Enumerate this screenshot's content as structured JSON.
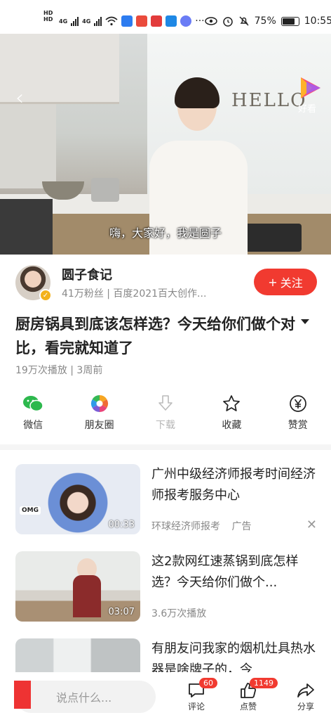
{
  "status_bar": {
    "network_labels": [
      "HD",
      "HD"
    ],
    "signal_labels": [
      "4G",
      "4G"
    ],
    "battery": "75%",
    "time": "10:55",
    "icons": [
      "wifi-icon",
      "app-icon-red",
      "app-icon-blue",
      "app-icon-music",
      "eye-icon",
      "alarm-icon",
      "mute-icon",
      "battery-icon"
    ]
  },
  "video": {
    "subtitle": "嗨，大家好，我是圆子",
    "logo_text": "好看",
    "back_icon": "chevron-left-icon",
    "wall_text": "HELLO"
  },
  "author": {
    "name": "圆子食记",
    "meta": "41万粉丝 | 百度2021百大创作...",
    "follow_label": "关注",
    "badge_icon": "verified-badge-icon"
  },
  "video_title": "厨房锅具到底该怎样选？今天给你们做个对比，看完就知道了",
  "video_stats": "19万次播放 | 3周前",
  "share_actions": [
    {
      "label": "微信",
      "icon": "wechat-icon",
      "enabled": true
    },
    {
      "label": "朋友圈",
      "icon": "moments-icon",
      "enabled": true
    },
    {
      "label": "下载",
      "icon": "download-icon",
      "enabled": false
    },
    {
      "label": "收藏",
      "icon": "star-icon",
      "enabled": true
    },
    {
      "label": "赞赏",
      "icon": "yen-icon",
      "enabled": true
    }
  ],
  "feed": [
    {
      "title": "广州中级经济师报考时间经济师报考服务中心",
      "meta_source": "环球经济师报考",
      "meta_tag": "广告",
      "duration": "00:33",
      "is_ad": true
    },
    {
      "title": "这2款网红速蒸锅到底怎样选？今天给你们做个...",
      "meta": "3.6万次播放",
      "duration": "03:07"
    },
    {
      "title": "有朋友问我家的烟机灶具热水器是啥牌子的，今"
    }
  ],
  "bottom_bar": {
    "comment_placeholder": "说点什么...",
    "comment_label": "评论",
    "comment_count": "60",
    "like_label": "点赞",
    "like_count": "1149",
    "share_label": "分享"
  },
  "colors": {
    "accent": "#f13a30",
    "muted_text": "#888888",
    "badge": "#f3b21b"
  }
}
